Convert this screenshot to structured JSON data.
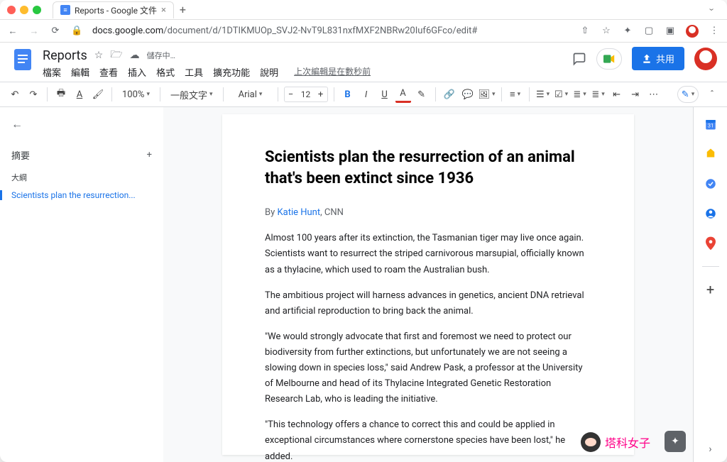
{
  "browser": {
    "tab_title": "Reports - Google 文件",
    "url_host": "docs.google.com",
    "url_path": "/document/d/1DTIKMUOp_SVJ2-NvT9L831nxfMXF2NBRw20Iuf6GFco/edit#"
  },
  "doc": {
    "title": "Reports",
    "saving": "儲存中…",
    "last_edit": "上次編輯是在數秒前",
    "share_label": "共用"
  },
  "menus": [
    "檔案",
    "編輯",
    "查看",
    "插入",
    "格式",
    "工具",
    "擴充功能",
    "說明"
  ],
  "toolbar": {
    "zoom": "100%",
    "styles": "一般文字",
    "font": "Arial",
    "font_size": "12"
  },
  "outline": {
    "summary": "摘要",
    "heading": "大綱",
    "items": [
      "Scientists plan the resurrection..."
    ]
  },
  "article": {
    "headline": "Scientists plan the resurrection of an animal that's been extinct since 1936",
    "byline_prefix": "By ",
    "byline_author": "Katie Hunt",
    "byline_suffix": ", CNN",
    "paragraphs": [
      "Almost 100 years after its extinction, the Tasmanian tiger may live once again. Scientists want to resurrect the striped carnivorous marsupial, officially known as a thylacine, which used to roam the Australian bush.",
      "The ambitious project will harness advances in genetics, ancient DNA retrieval and artificial reproduction to bring back the animal.",
      "\"We would strongly advocate that first and foremost we need to protect our biodiversity from further extinctions, but unfortunately we are not seeing a slowing down in species loss,\" said Andrew Pask, a professor at the University of Melbourne and head of its Thylacine Integrated Genetic Restoration Research Lab, who is leading the initiative.",
      "\"This technology offers a chance to correct this and could be applied in exceptional circumstances where cornerstone species have been lost,\" he added."
    ]
  },
  "watermark": "塔科女子"
}
